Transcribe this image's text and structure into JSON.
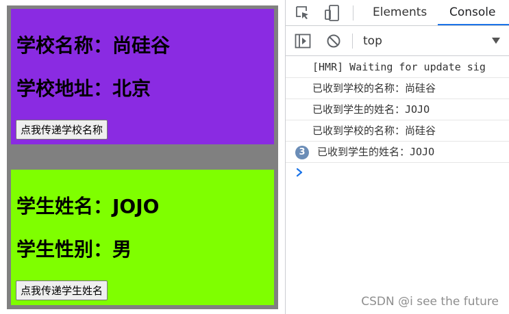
{
  "school": {
    "name_line": "学校名称：尚硅谷",
    "address_line": "学校地址：北京",
    "button_label": "点我传递学校名称",
    "bg_color": "#8a2be2"
  },
  "student": {
    "name_line": "学生姓名：JOJO",
    "gender_line": "学生性别：男",
    "button_label": "点我传递学生姓名",
    "bg_color": "#7fff00"
  },
  "app_wrap_color": "#808080",
  "devtools": {
    "tabs": [
      {
        "label": "Elements",
        "active": false
      },
      {
        "label": "Console",
        "active": true
      }
    ],
    "icons": {
      "inspect": "inspect-element-icon",
      "device": "device-toolbar-icon",
      "sidebar": "console-sidebar-icon",
      "clear": "clear-console-icon",
      "dropdown": "chevron-down-icon",
      "prompt": "console-prompt-chevron-icon"
    },
    "context": "top",
    "messages": [
      {
        "text": "[HMR] Waiting for update sig",
        "count": null
      },
      {
        "text": "已收到学校的名称：尚硅谷",
        "count": null
      },
      {
        "text": "已收到学生的姓名：JOJO",
        "count": null
      },
      {
        "text": "已收到学校的名称：尚硅谷",
        "count": null
      },
      {
        "text": "已收到学生的姓名：JOJO",
        "count": "3"
      }
    ],
    "accent": "#1a73e8",
    "badge_color": "#6b8db7"
  },
  "watermark": "CSDN @i see the future"
}
